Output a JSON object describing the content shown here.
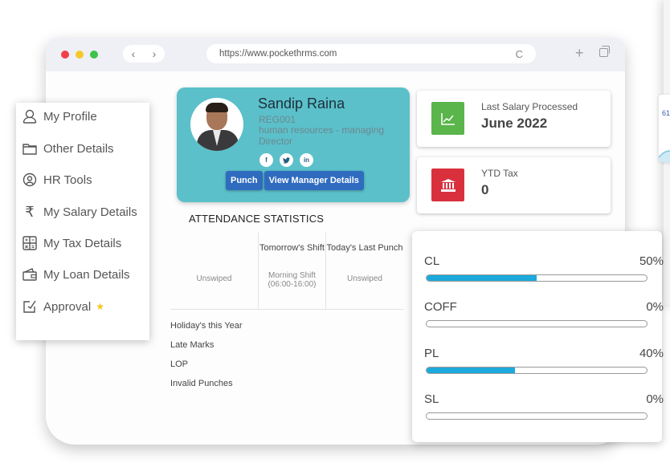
{
  "browser": {
    "url": "https://www.pockethrms.com",
    "nav_back": "‹",
    "nav_forward": "›",
    "reload_icon": "C",
    "new_tab_icon": "+"
  },
  "profile": {
    "name": "Sandip Raina",
    "employee_id": "REG001",
    "role": "human resources - managing Director",
    "socials": [
      "f",
      "t",
      "in"
    ],
    "buttons": {
      "punch": "Punch",
      "view_manager": "View Manager Details"
    }
  },
  "stats": {
    "last_salary": {
      "label": "Last Salary Processed",
      "value": "June 2022",
      "color": "#5ab54a"
    },
    "ytd_tax": {
      "label": "YTD Tax",
      "value": "0",
      "color": "#d9303d"
    }
  },
  "attendance": {
    "title": "ATTENDANCE STATISTICS",
    "columns": [
      {
        "header": "",
        "value": "Unswiped"
      },
      {
        "header": "Tomorrow's Shift",
        "value": "Morning Shift (06:00-16:00)"
      },
      {
        "header": "Today's Last Punch",
        "value": "Unswiped"
      }
    ],
    "list": [
      "Holiday's this Year",
      "Late Marks",
      "LOP",
      "Invalid Punches"
    ]
  },
  "menu": {
    "items": [
      {
        "label": "My Profile",
        "icon": "user-icon"
      },
      {
        "label": "Other Details",
        "icon": "folder-icon"
      },
      {
        "label": "HR Tools",
        "icon": "hr-tools-icon"
      },
      {
        "label": "My Salary Details",
        "icon": "rupee-icon"
      },
      {
        "label": "My Tax Details",
        "icon": "calculator-icon"
      },
      {
        "label": "My Loan Details",
        "icon": "wallet-icon"
      },
      {
        "label": "Approval",
        "icon": "approval-icon",
        "badge": "★"
      }
    ]
  },
  "leaves": {
    "accent": "#1ca9db",
    "items": [
      {
        "name": "CL",
        "percent_label": "50%",
        "fill": 0.5
      },
      {
        "name": "COFF",
        "percent_label": "0%",
        "fill": 0
      },
      {
        "name": "PL",
        "percent_label": "40%",
        "fill": 0.4
      },
      {
        "name": "SL",
        "percent_label": "0%",
        "fill": 0
      }
    ]
  },
  "peek": {
    "value": "61"
  }
}
